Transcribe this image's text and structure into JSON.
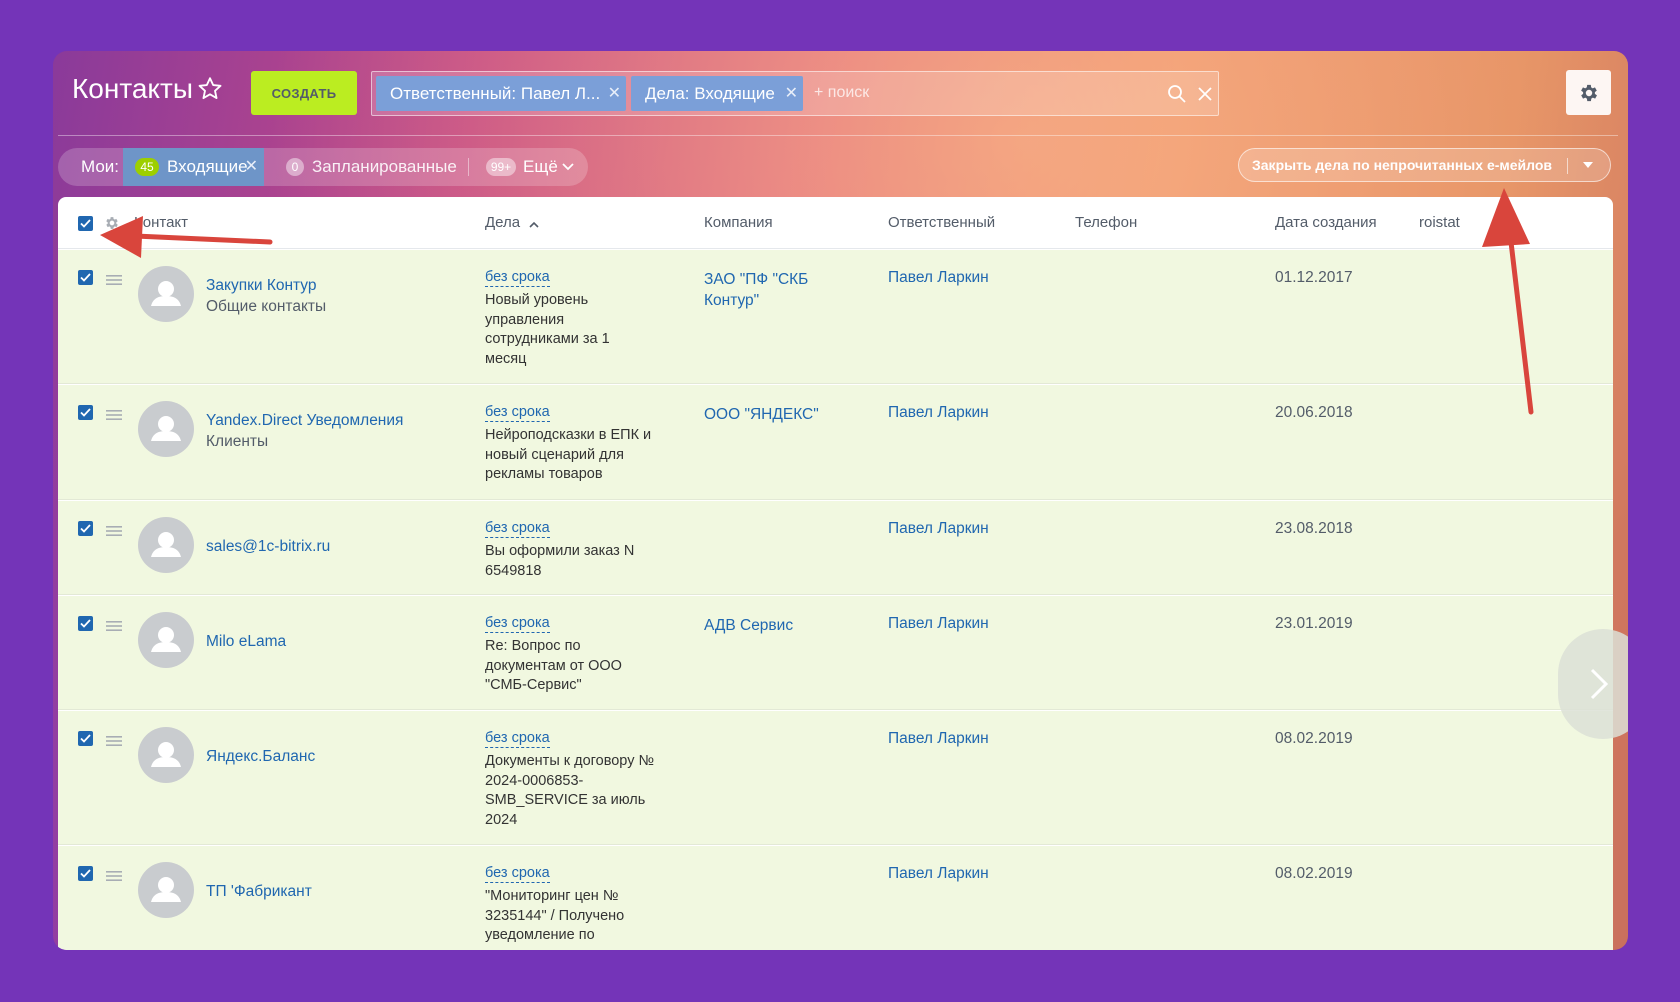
{
  "header": {
    "title": "Контакты",
    "create_label": "СОЗДАТЬ",
    "filter_chips": [
      {
        "label": "Ответственный: Павел Л..."
      },
      {
        "label": "Дела: Входящие"
      }
    ],
    "search_placeholder": "+ поиск"
  },
  "counters": {
    "label": "Мои:",
    "tabs": [
      {
        "count": "45",
        "label": "Входящие"
      },
      {
        "count": "0",
        "label": "Запланированные"
      },
      {
        "count": "99+",
        "label": "Ещё"
      }
    ]
  },
  "close_action_label": "Закрыть дела по непрочитанных е-мейлов",
  "columns": {
    "contact": "Контакт",
    "deals": "Дела",
    "company": "Компания",
    "responsible": "Ответственный",
    "phone": "Телефон",
    "created": "Дата создания",
    "roistat": "roistat"
  },
  "rows": [
    {
      "name": "Закупки Контур",
      "type": "Общие контакты",
      "deal_link": "без срока",
      "deal_text": "Новый уровень управления сотрудниками за 1 месяц",
      "company": "ЗАО \"ПФ \"СКБ Контур\"",
      "responsible": "Павел Ларкин",
      "date": "01.12.2017"
    },
    {
      "name": "Yandex.Direct Уведомления",
      "type": "Клиенты",
      "deal_link": "без срока",
      "deal_text": "Нейроподсказки в ЕПК и новый сценарий для рекламы товаров",
      "company": "ООО \"ЯНДЕКС\"",
      "responsible": "Павел Ларкин",
      "date": "20.06.2018"
    },
    {
      "name": "sales@1c-bitrix.ru",
      "type": "",
      "deal_link": "без срока",
      "deal_text": "Вы оформили заказ N 6549818",
      "company": "",
      "responsible": "Павел Ларкин",
      "date": "23.08.2018"
    },
    {
      "name": "Milo eLama",
      "type": "",
      "deal_link": "без срока",
      "deal_text": "Re: Вопрос по документам от ООО \"СМБ-Сервис\"",
      "company": "АДВ Сервис",
      "responsible": "Павел Ларкин",
      "date": "23.01.2019"
    },
    {
      "name": "Яндекс.Баланс",
      "type": "",
      "deal_link": "без срока",
      "deal_text": "Документы к договору № 2024-0006853-SMB_SERVICE за июль 2024",
      "company": "",
      "responsible": "Павел Ларкин",
      "date": "08.02.2019"
    },
    {
      "name": "ТП 'Фабрикант",
      "type": "",
      "deal_link": "без срока",
      "deal_text": "\"Мониторинг цен № 3235144\" / Получено уведомление по",
      "company": "",
      "responsible": "Павел Ларкин",
      "date": "08.02.2019"
    }
  ],
  "colors": {
    "background": "#7434b8",
    "create_button": "#bbed21",
    "chip": "#7b9fd8",
    "row_background": "#f1f8e0",
    "link": "#2067b0",
    "annotation_arrow": "#d9453c"
  }
}
